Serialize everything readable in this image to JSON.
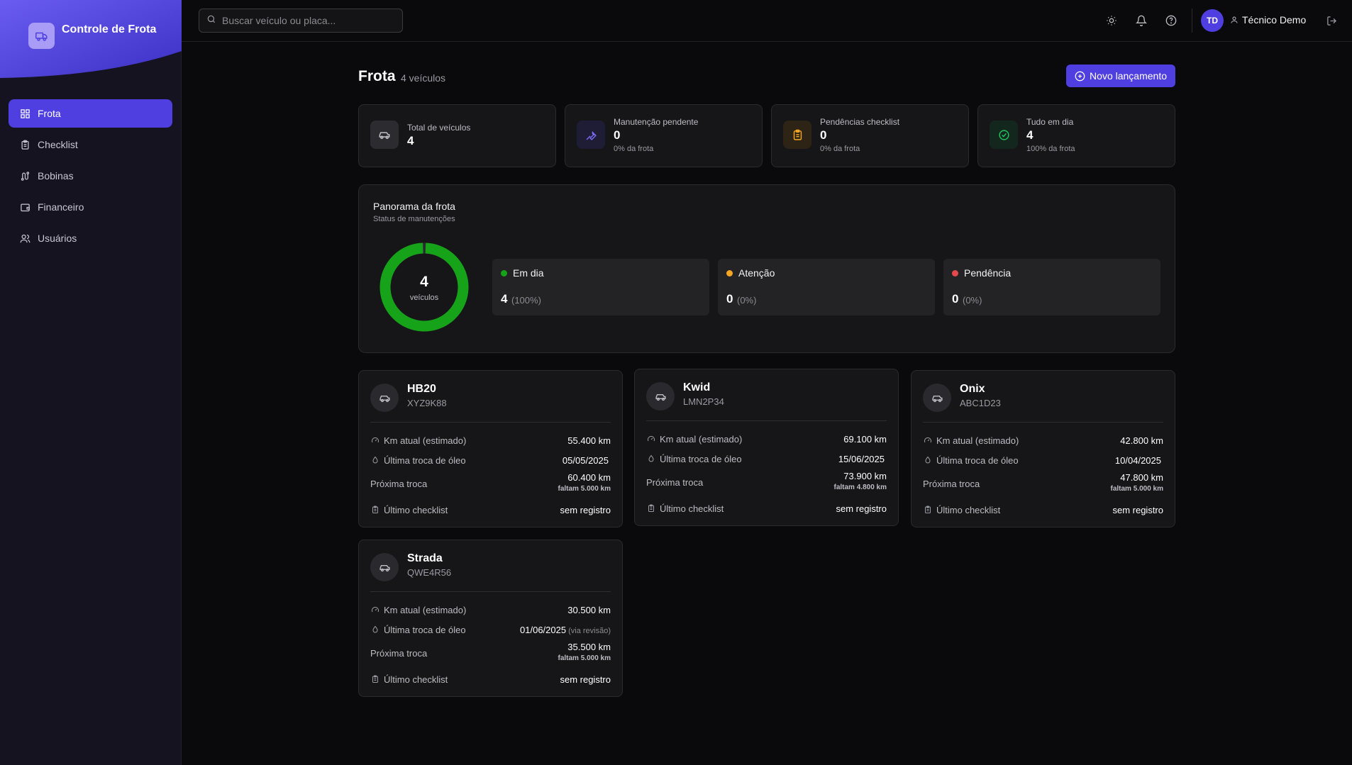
{
  "app": {
    "title": "Controle de Frota"
  },
  "sidebar": {
    "items": [
      {
        "label": "Frota",
        "icon": "grid-icon",
        "active": true
      },
      {
        "label": "Checklist",
        "icon": "clipboard-icon",
        "active": false
      },
      {
        "label": "Bobinas",
        "icon": "route-icon",
        "active": false
      },
      {
        "label": "Financeiro",
        "icon": "wallet-icon",
        "active": false
      },
      {
        "label": "Usuários",
        "icon": "users-icon",
        "active": false
      }
    ]
  },
  "topbar": {
    "search_placeholder": "Buscar veículo ou placa...",
    "icons": [
      "sun-icon",
      "bell-icon",
      "help-icon",
      "logout-icon"
    ],
    "user": {
      "initials": "TD",
      "name": "Técnico Demo"
    }
  },
  "page": {
    "title": "Frota",
    "count": "4 veículos",
    "new_button": "Novo lançamento"
  },
  "stats": [
    {
      "label": "Total de veículos",
      "value": "4",
      "sub": "",
      "icon": "car-icon",
      "color": "#2c2c30"
    },
    {
      "label": "Manutenção pendente",
      "value": "0",
      "sub": "0% da frota",
      "icon": "wrench-icon",
      "color": "#1f1d35"
    },
    {
      "label": "Pendências checklist",
      "value": "0",
      "sub": "0% da frota",
      "icon": "clipboard-icon",
      "color": "#2e2415"
    },
    {
      "label": "Tudo em dia",
      "value": "4",
      "sub": "100% da frota",
      "icon": "check-circle-icon",
      "color": "#13271f"
    }
  ],
  "panorama": {
    "title": "Panorama da frota",
    "subtitle": "Status de manutenções",
    "donut": {
      "value": "4",
      "label": "veículos",
      "fraction_ok": 1.0
    },
    "statuses": [
      {
        "name": "Em dia",
        "value": "4",
        "pct": "(100%)",
        "color": "#16a31a"
      },
      {
        "name": "Atenção",
        "value": "0",
        "pct": "(0%)",
        "color": "#f5a623"
      },
      {
        "name": "Pendência",
        "value": "0",
        "pct": "(0%)",
        "color": "#e5484d"
      }
    ]
  },
  "vehicle_labels": {
    "km": "Km atual (estimado)",
    "oil": "Última troca de óleo",
    "next": "Próxima troca",
    "checklist": "Último checklist"
  },
  "vehicles": [
    {
      "name": "HB20",
      "plate": "XYZ9K88",
      "km": "55.400 km",
      "oil": "05/05/2025",
      "oil_extra": "",
      "next": "60.400 km",
      "next_sub": "faltam 5.000 km",
      "checklist": "sem registro"
    },
    {
      "name": "Kwid",
      "plate": "LMN2P34",
      "km": "69.100 km",
      "oil": "15/06/2025",
      "oil_extra": "",
      "next": "73.900 km",
      "next_sub": "faltam 4.800 km",
      "checklist": "sem registro"
    },
    {
      "name": "Onix",
      "plate": "ABC1D23",
      "km": "42.800 km",
      "oil": "10/04/2025",
      "oil_extra": "",
      "next": "47.800 km",
      "next_sub": "faltam 5.000 km",
      "checklist": "sem registro"
    },
    {
      "name": "Strada",
      "plate": "QWE4R56",
      "km": "30.500 km",
      "oil": "01/06/2025",
      "oil_extra": "(via revisão)",
      "next": "35.500 km",
      "next_sub": "faltam 5.000 km",
      "checklist": "sem registro"
    }
  ]
}
